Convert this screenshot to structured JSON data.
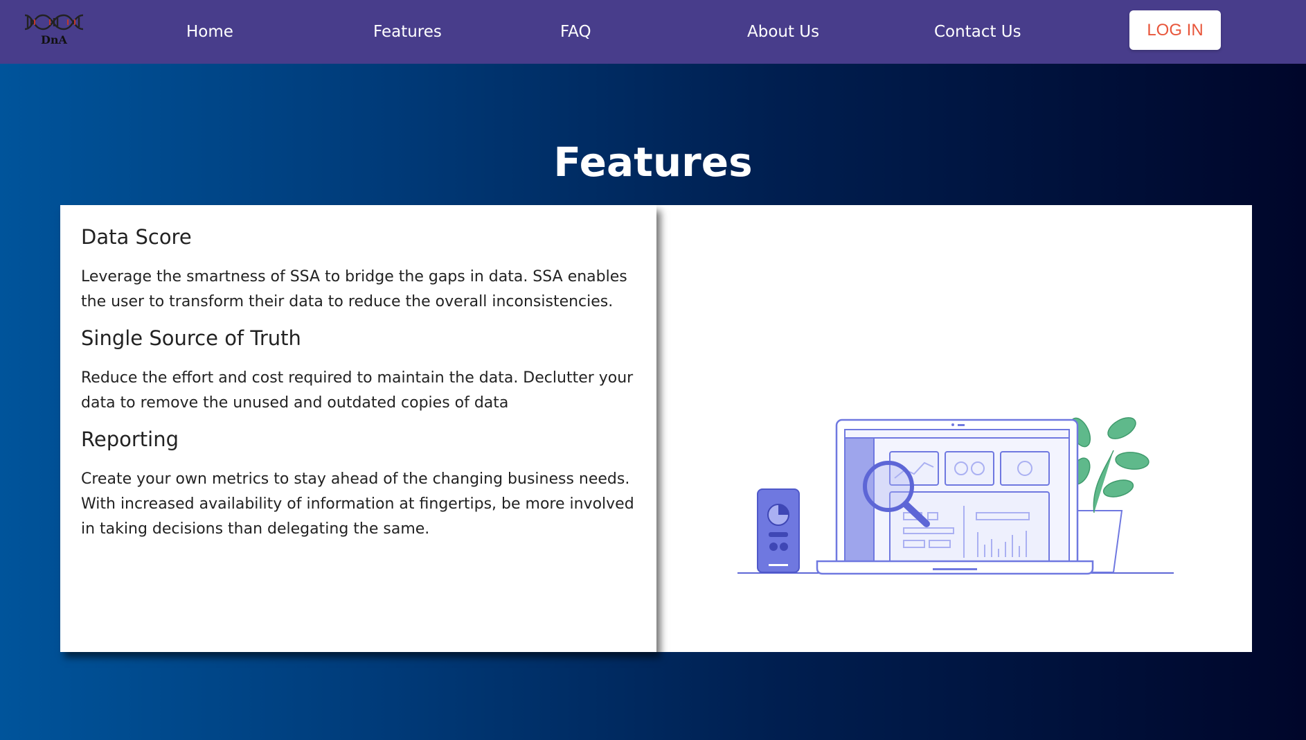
{
  "nav": {
    "logo_text": "DnA",
    "links": [
      "Home",
      "Features",
      "FAQ",
      "About Us",
      "Contact Us"
    ],
    "login_label": "LOG IN"
  },
  "page": {
    "title": "Features"
  },
  "features": [
    {
      "title": "Data Score",
      "description": "Leverage the smartness of SSA to bridge the gaps in data. SSA enables the user to transform their data to reduce the overall inconsistencies."
    },
    {
      "title": "Single Source of Truth",
      "description": "Reduce the effort and cost required to maintain the data. Declutter your data to remove the unused and outdated copies of data"
    },
    {
      "title": "Reporting",
      "description": "Create your own metrics to stay ahead of the changing business needs. With increased availability of information at fingertips, be more involved in taking decisions than delegating the same."
    }
  ],
  "colors": {
    "navbar": "#483d8b",
    "login_text": "#e8553a",
    "illustration_accent": "#6f78e0",
    "plant": "#5fb98b"
  }
}
